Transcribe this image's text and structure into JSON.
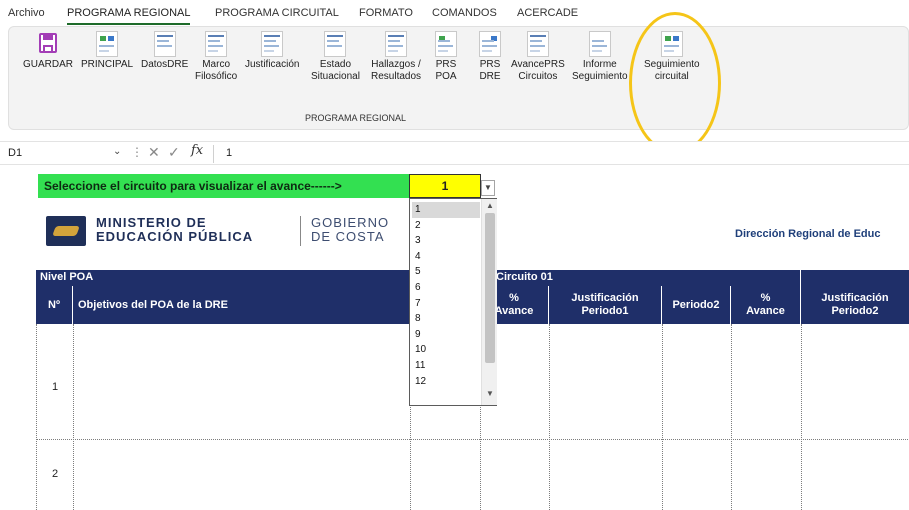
{
  "menu": {
    "tabs": [
      "Archivo",
      "PROGRAMA REGIONAL",
      "PROGRAMA CIRCUITAL",
      "FORMATO",
      "COMANDOS",
      "ACERCADE"
    ],
    "active": "PROGRAMA REGIONAL"
  },
  "ribbon": {
    "buttons": [
      {
        "line1": "GUARDAR",
        "line2": ""
      },
      {
        "line1": "PRINCIPAL",
        "line2": ""
      },
      {
        "line1": "DatosDRE",
        "line2": ""
      },
      {
        "line1": "Marco",
        "line2": "Filosófico"
      },
      {
        "line1": "Justificación",
        "line2": ""
      },
      {
        "line1": "Estado",
        "line2": "Situacional"
      },
      {
        "line1": "Hallazgos /",
        "line2": "Resultados"
      },
      {
        "line1": "PRS",
        "line2": "POA"
      },
      {
        "line1": "PRS",
        "line2": "DRE"
      },
      {
        "line1": "AvancePRS",
        "line2": "Circuitos"
      },
      {
        "line1": "Informe",
        "line2": "Seguimiento"
      },
      {
        "line1": "Seguimiento",
        "line2": "circuital"
      }
    ],
    "group_label": "PROGRAMA REGIONAL"
  },
  "formula_bar": {
    "cell_ref": "D1",
    "fx": "fx",
    "value": "1"
  },
  "sheet": {
    "prompt": "Seleccione el circuito para visualizar el avance------>",
    "selected_circuit": "1",
    "logo_line1": "MINISTERIO DE",
    "logo_line2": "EDUCACIÓN PÚBLICA",
    "gov_line1": "GOBIERNO",
    "gov_line2": "DE COSTA",
    "direccion": "Dirección Regional de Educ",
    "nivel_poa": "Nivel POA",
    "circuito": "Circuito 01",
    "headers": {
      "num": "Nº",
      "objetivos": "Objetivos del POA de la DRE",
      "avance1_a": "%",
      "avance1_b": "Avance",
      "just1_a": "Justificación",
      "just1_b": "Periodo1",
      "periodo2": "Periodo2",
      "avance2_a": "%",
      "avance2_b": "Avance",
      "just2_a": "Justificación",
      "just2_b": "Periodo2"
    },
    "rows": [
      "1",
      "2"
    ]
  },
  "dropdown": {
    "items": [
      "1",
      "2",
      "3",
      "4",
      "5",
      "6",
      "7",
      "8",
      "9",
      "10",
      "11",
      "12"
    ],
    "selected": "1"
  },
  "colors": {
    "prompt_bg": "#33e051",
    "select_bg": "#ffff00",
    "header_bg": "#1f2f69",
    "highlight_circle": "#f5c518"
  }
}
